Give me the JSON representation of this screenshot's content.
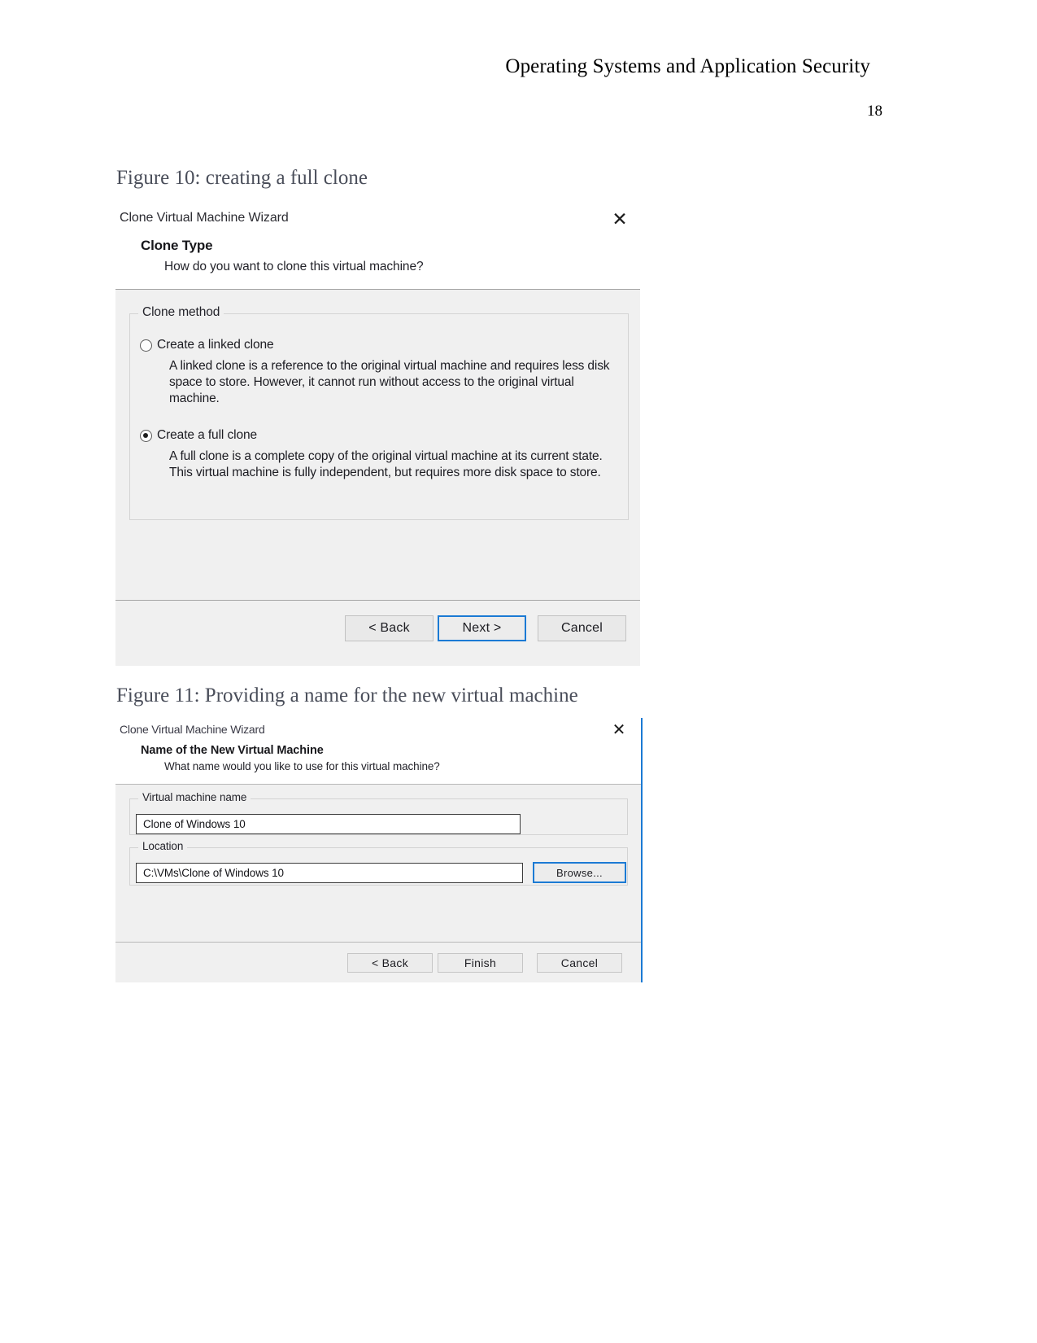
{
  "document": {
    "header_title": "Operating Systems and Application Security",
    "page_number": "18"
  },
  "figures": [
    {
      "caption": "Figure 10: creating a full clone",
      "dialog": {
        "window_title": "Clone Virtual Machine Wizard",
        "close_icon": "close-icon",
        "header_title": "Clone Type",
        "header_subtitle": "How do you want to clone this virtual machine?",
        "group_legend": "Clone method",
        "options": [
          {
            "label": "Create a linked clone",
            "selected": false,
            "description": "A linked clone is a reference to the original virtual machine and requires less disk space to store. However, it cannot run without access to the original virtual machine."
          },
          {
            "label": "Create a full clone",
            "selected": true,
            "description": "A full clone is a complete copy of the original virtual machine at its current state. This virtual machine is fully independent, but requires more disk space to store."
          }
        ],
        "buttons": {
          "back": "< Back",
          "next": "Next >",
          "cancel": "Cancel"
        },
        "focus_color": "#1b7ad4"
      }
    },
    {
      "caption": "Figure 11: Providing a name for the new virtual machine",
      "dialog": {
        "window_title": "Clone Virtual Machine Wizard",
        "close_icon": "close-icon",
        "header_title": "Name of the New Virtual Machine",
        "header_subtitle": "What name would you like to use for this virtual machine?",
        "name_group_legend": "Virtual machine name",
        "name_value": "Clone of Windows 10",
        "location_group_legend": "Location",
        "location_value": "C:\\VMs\\Clone of Windows 10",
        "browse_label": "Browse...",
        "buttons": {
          "back": "< Back",
          "finish": "Finish",
          "cancel": "Cancel"
        },
        "focus_color": "#1b7ad4"
      }
    }
  ]
}
